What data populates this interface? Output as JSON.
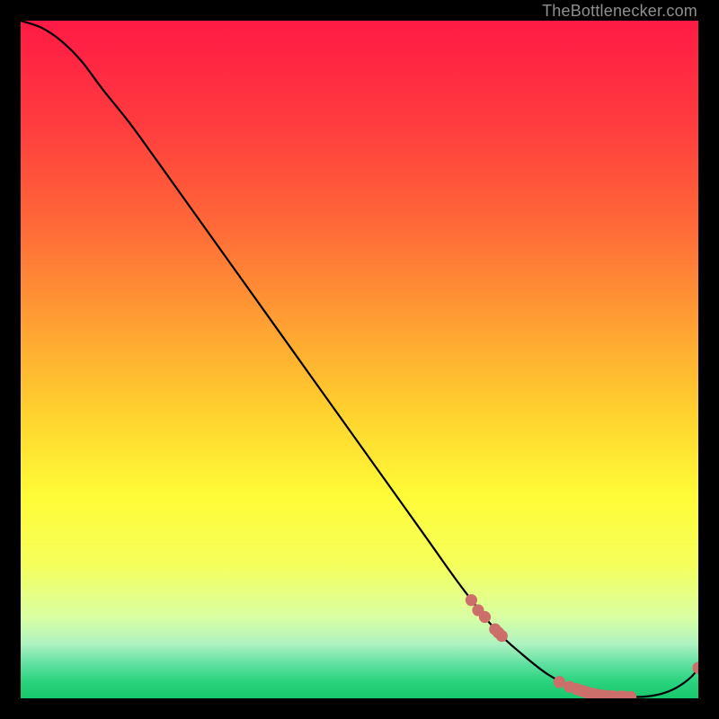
{
  "attribution": "TheBottlenecker.com",
  "colors": {
    "bg": "#000000",
    "curve": "#000000",
    "marker_fill": "#cc6f6a",
    "marker_stroke": "#cc6f6a",
    "attribution": "#8f8f8f",
    "gradient_stops": [
      {
        "offset": 0.0,
        "color": "#ff1a45"
      },
      {
        "offset": 0.15,
        "color": "#ff3b3f"
      },
      {
        "offset": 0.3,
        "color": "#ff6838"
      },
      {
        "offset": 0.45,
        "color": "#ffa133"
      },
      {
        "offset": 0.58,
        "color": "#ffd22f"
      },
      {
        "offset": 0.7,
        "color": "#fffb37"
      },
      {
        "offset": 0.8,
        "color": "#f6ff5a"
      },
      {
        "offset": 0.88,
        "color": "#daffa3"
      },
      {
        "offset": 0.92,
        "color": "#aef2c1"
      },
      {
        "offset": 0.95,
        "color": "#5ee0a0"
      },
      {
        "offset": 0.975,
        "color": "#2bd37e"
      },
      {
        "offset": 1.0,
        "color": "#18c86c"
      }
    ]
  },
  "chart_data": {
    "type": "line",
    "title": "",
    "xlabel": "",
    "ylabel": "",
    "xlim": [
      0,
      100
    ],
    "ylim": [
      0,
      100
    ],
    "curve_note": "y values are percent-above-minimum; bottom of plot = 0",
    "series": [
      {
        "name": "curve",
        "x": [
          0,
          3,
          6,
          9,
          12,
          16,
          20,
          25,
          30,
          35,
          40,
          45,
          50,
          55,
          60,
          65,
          70,
          74,
          78,
          82,
          85,
          88,
          91,
          93,
          95,
          97,
          99,
          100
        ],
        "y": [
          100,
          99,
          97,
          94,
          90,
          85,
          79.5,
          72.5,
          65.5,
          58.5,
          51.5,
          44.5,
          37.5,
          30.5,
          23.5,
          16.5,
          10.2,
          6.5,
          3.4,
          1.4,
          0.6,
          0.25,
          0.2,
          0.35,
          0.8,
          1.7,
          3.2,
          4.5
        ]
      }
    ],
    "markers": {
      "name": "highlighted points",
      "note": "clustered along curve near minimum and slightly up the right tail",
      "x": [
        66.5,
        67.5,
        68.5,
        70.0,
        70.5,
        71.0,
        79.5,
        79.5,
        81.0,
        82.0,
        82.5,
        83.0,
        83.5,
        84.0,
        84.5,
        85.0,
        85.5,
        86.0,
        86.5,
        87.0,
        87.5,
        88.5,
        89.0,
        90.0,
        100.0
      ],
      "y": [
        14.5,
        13.0,
        12.0,
        10.2,
        9.7,
        9.2,
        2.4,
        2.4,
        1.7,
        1.4,
        1.2,
        1.05,
        0.9,
        0.75,
        0.65,
        0.55,
        0.45,
        0.4,
        0.33,
        0.3,
        0.3,
        0.27,
        0.25,
        0.22,
        4.5
      ]
    }
  }
}
